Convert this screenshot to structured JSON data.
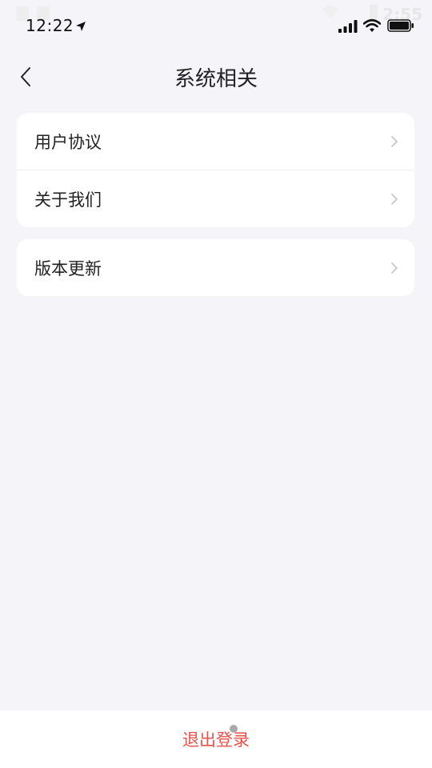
{
  "status_bar": {
    "time": "12:22",
    "ghost_time": "2:55",
    "icons": [
      "location-arrow-icon",
      "signal-bars-icon",
      "wifi-icon",
      "battery-icon"
    ]
  },
  "nav": {
    "title": "系统相关",
    "back_icon": "chevron-left-icon"
  },
  "groups": [
    {
      "items": [
        {
          "label": "用户协议",
          "icon": "chevron-right-icon"
        },
        {
          "label": "关于我们",
          "icon": "chevron-right-icon"
        }
      ]
    },
    {
      "items": [
        {
          "label": "版本更新",
          "icon": "chevron-right-icon"
        }
      ]
    }
  ],
  "logout": {
    "label": "退出登录"
  },
  "colors": {
    "background": "#f5f5f9",
    "card": "#ffffff",
    "text": "#222222",
    "chevron": "#c4c4c8",
    "logout": "#e8524a"
  }
}
